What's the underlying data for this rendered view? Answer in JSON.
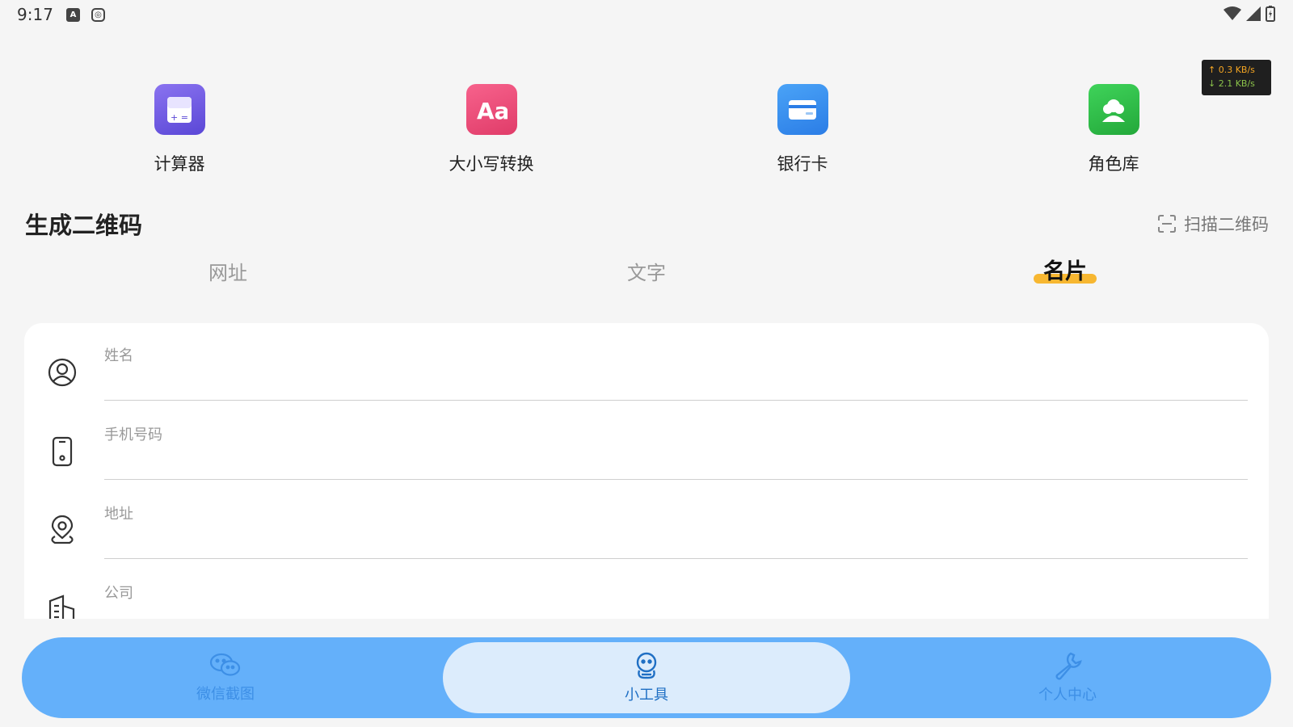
{
  "status": {
    "time": "9:17",
    "icons": [
      "a-icon",
      "notification-icon",
      "wifi-icon",
      "signal-icon",
      "battery-icon"
    ],
    "net_up": "↑ 0.3 KB/s",
    "net_down": "↓ 2.1 KB/s"
  },
  "tools": [
    {
      "label": "计算器",
      "icon": "calculator-icon",
      "color": "#6f5ce6"
    },
    {
      "label": "大小写转换",
      "icon": "case-convert-icon",
      "color": "#ee4d78"
    },
    {
      "label": "银行卡",
      "icon": "bank-card-icon",
      "color": "#3a8ff0"
    },
    {
      "label": "角色库",
      "icon": "character-library-icon",
      "color": "#2fbf4a"
    }
  ],
  "section": {
    "title": "生成二维码",
    "scan_label": "扫描二维码"
  },
  "tabs": [
    {
      "label": "网址",
      "active": false
    },
    {
      "label": "文字",
      "active": false
    },
    {
      "label": "名片",
      "active": true
    }
  ],
  "colors": {
    "accent": "#f7b731",
    "nav_bg": "#64b0fa",
    "nav_active_bg": "#dcecfc"
  },
  "form": {
    "fields": [
      {
        "label": "姓名",
        "value": "",
        "icon": "person-icon"
      },
      {
        "label": "手机号码",
        "value": "",
        "icon": "phone-icon"
      },
      {
        "label": "地址",
        "value": "",
        "icon": "location-icon"
      },
      {
        "label": "公司",
        "value": "",
        "icon": "building-icon"
      }
    ]
  },
  "nav": [
    {
      "label": "微信截图",
      "icon": "wechat-icon",
      "active": false
    },
    {
      "label": "小工具",
      "icon": "tools-icon",
      "active": true
    },
    {
      "label": "个人中心",
      "icon": "wrench-icon",
      "active": false
    }
  ]
}
